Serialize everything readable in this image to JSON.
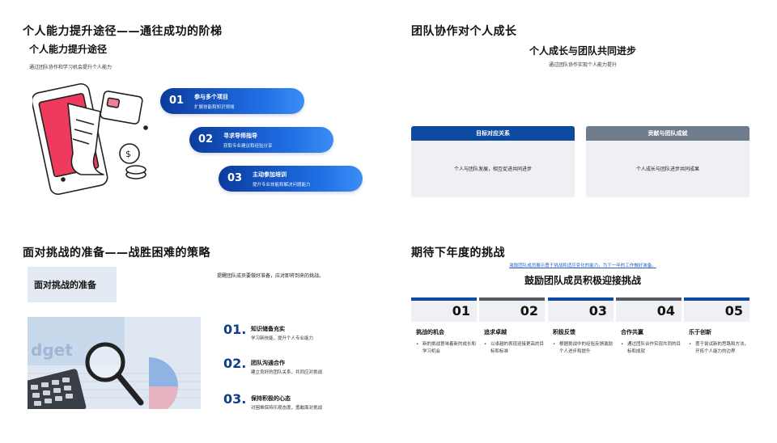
{
  "slide1": {
    "title": "个人能力提升途径——通往成功的阶梯",
    "subtitle": "个人能力提升途径",
    "caption": "通过团队协作和学习机会提升个人能力",
    "items": [
      {
        "num": "01",
        "title": "参与多个项目",
        "desc": "扩展技能和知识领域"
      },
      {
        "num": "02",
        "title": "寻求导师指导",
        "desc": "获取专业建议和经验分享"
      },
      {
        "num": "03",
        "title": "主动参加培训",
        "desc": "提升专业技能和解决问题能力"
      }
    ]
  },
  "slide2": {
    "title": "团队协作对个人成长",
    "center_title": "个人成长与团队共同进步",
    "center_sub": "通过团队协作实现个人能力提升",
    "cards": [
      {
        "header": "目标对应关系",
        "body": "个人与团队发展，相互促进共同进步"
      },
      {
        "header": "贡献与团队成就",
        "body": "个人成长与团队进步共同成果"
      }
    ],
    "colors": {
      "card1": "#0e4a9f",
      "card2": "#6f7c8c"
    }
  },
  "slide3": {
    "title": "面对挑战的准备——战胜困难的策略",
    "box_title": "面对挑战的准备",
    "note": "提醒团队成员要做好准备，应对即将到来的挑战。",
    "items": [
      {
        "num": "01.",
        "title": "知识储备充实",
        "desc": "学习新技能，提升个人专业能力"
      },
      {
        "num": "02.",
        "title": "团队沟通合作",
        "desc": "建立良好的团队关系，共同应对挑战"
      },
      {
        "num": "03.",
        "title": "保持积极的心态",
        "desc": "对困难保持乐观态度，勇敢面对挑战"
      }
    ]
  },
  "slide4": {
    "title": "期待下年度的挑战",
    "link": "激励团队成员展示勇于挑战和适应变化的能力，为下一年的工作做好准备。",
    "center_title": "鼓励团队成员积极迎接挑战",
    "columns": [
      {
        "num": "01",
        "title": "挑战的机会",
        "desc": "新的挑战意味着新的成长和学习机会",
        "color": "#0e4a9f"
      },
      {
        "num": "02",
        "title": "追求卓越",
        "desc": "以卓越的表现迎接更高的目标和标准",
        "color": "#555a63"
      },
      {
        "num": "03",
        "title": "积极反馈",
        "desc": "根据挑战中的经验反馈激励个人进步和提升",
        "color": "#0e4a9f"
      },
      {
        "num": "04",
        "title": "合作共赢",
        "desc": "通过团队合作实现共同的目标和成就",
        "color": "#555a63"
      },
      {
        "num": "05",
        "title": "乐于创新",
        "desc": "勇于尝试新的思路和方法，开拓个人能力的边界",
        "color": "#0e4a9f"
      }
    ]
  }
}
